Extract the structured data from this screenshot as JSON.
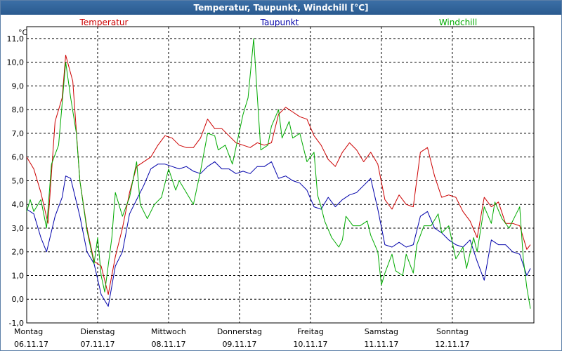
{
  "window": {
    "title": "Temperatur, Taupunkt, Windchill [°C]"
  },
  "chart_data": {
    "type": "line",
    "title": "Temperatur, Taupunkt, Windchill [°C]",
    "ylabel": "°C",
    "ylim": [
      -1,
      11.5
    ],
    "xlim": [
      0,
      7.15
    ],
    "grid": true,
    "legend_placement": "top",
    "y_ticks": [
      "11,0",
      "10,0",
      "9,0",
      "8,0",
      "7,0",
      "6,0",
      "5,0",
      "4,0",
      "3,0",
      "2,0",
      "1,0",
      "0,0",
      "-1,0"
    ],
    "x_ticks": [
      {
        "day": "Montag",
        "date": "06.11.17"
      },
      {
        "day": "Dienstag",
        "date": "07.11.17"
      },
      {
        "day": "Mittwoch",
        "date": "08.11.17"
      },
      {
        "day": "Donnerstag",
        "date": "09.11.17"
      },
      {
        "day": "Freitag",
        "date": "10.11.17"
      },
      {
        "day": "Samstag",
        "date": "11.11.17"
      },
      {
        "day": "Sonntag",
        "date": "12.11.17"
      }
    ],
    "series": [
      {
        "name": "Temperatur",
        "color": "#cc0000",
        "points": [
          [
            0,
            6
          ],
          [
            0.1,
            5.5
          ],
          [
            0.2,
            4.5
          ],
          [
            0.3,
            3.2
          ],
          [
            0.4,
            7.5
          ],
          [
            0.5,
            8.5
          ],
          [
            0.55,
            10.3
          ],
          [
            0.65,
            9.2
          ],
          [
            0.75,
            5
          ],
          [
            0.85,
            3
          ],
          [
            0.95,
            1.6
          ],
          [
            1.05,
            1.4
          ],
          [
            1.15,
            0.2
          ],
          [
            1.25,
            1.8
          ],
          [
            1.35,
            3
          ],
          [
            1.45,
            4.5
          ],
          [
            1.55,
            5.6
          ],
          [
            1.65,
            5.8
          ],
          [
            1.75,
            6
          ],
          [
            1.85,
            6.5
          ],
          [
            1.95,
            6.9
          ],
          [
            2.05,
            6.8
          ],
          [
            2.15,
            6.5
          ],
          [
            2.25,
            6.4
          ],
          [
            2.35,
            6.4
          ],
          [
            2.45,
            6.8
          ],
          [
            2.55,
            7.6
          ],
          [
            2.65,
            7.2
          ],
          [
            2.75,
            7.2
          ],
          [
            2.85,
            6.9
          ],
          [
            2.95,
            6.6
          ],
          [
            3.05,
            6.5
          ],
          [
            3.15,
            6.4
          ],
          [
            3.25,
            6.6
          ],
          [
            3.35,
            6.5
          ],
          [
            3.45,
            6.6
          ],
          [
            3.55,
            7.8
          ],
          [
            3.65,
            8.1
          ],
          [
            3.75,
            7.9
          ],
          [
            3.85,
            7.7
          ],
          [
            3.95,
            7.6
          ],
          [
            4.05,
            6.9
          ],
          [
            4.15,
            6.5
          ],
          [
            4.25,
            5.9
          ],
          [
            4.35,
            5.6
          ],
          [
            4.45,
            6.2
          ],
          [
            4.55,
            6.6
          ],
          [
            4.65,
            6.3
          ],
          [
            4.75,
            5.8
          ],
          [
            4.85,
            6.2
          ],
          [
            4.95,
            5.7
          ],
          [
            5.05,
            4.2
          ],
          [
            5.15,
            3.8
          ],
          [
            5.25,
            4.4
          ],
          [
            5.35,
            4.0
          ],
          [
            5.45,
            3.9
          ],
          [
            5.55,
            6.2
          ],
          [
            5.65,
            6.4
          ],
          [
            5.75,
            5.2
          ],
          [
            5.85,
            4.3
          ],
          [
            5.95,
            4.4
          ],
          [
            6.05,
            4.3
          ],
          [
            6.15,
            3.7
          ],
          [
            6.25,
            3.3
          ],
          [
            6.35,
            2.6
          ],
          [
            6.45,
            4.3
          ],
          [
            6.55,
            3.9
          ],
          [
            6.65,
            4.1
          ],
          [
            6.75,
            3.2
          ],
          [
            6.85,
            3.2
          ],
          [
            6.95,
            3.1
          ],
          [
            7.05,
            2.1
          ],
          [
            7.1,
            2.3
          ]
        ]
      },
      {
        "name": "Taupunkt",
        "color": "#0000aa",
        "points": [
          [
            0,
            3.8
          ],
          [
            0.1,
            3.6
          ],
          [
            0.2,
            2.6
          ],
          [
            0.28,
            2
          ],
          [
            0.4,
            3.5
          ],
          [
            0.5,
            4.3
          ],
          [
            0.55,
            5.2
          ],
          [
            0.62,
            5.1
          ],
          [
            0.75,
            3.5
          ],
          [
            0.85,
            2.0
          ],
          [
            0.95,
            1.5
          ],
          [
            1.05,
            0.2
          ],
          [
            1.15,
            -0.3
          ],
          [
            1.25,
            1.4
          ],
          [
            1.35,
            2.0
          ],
          [
            1.45,
            3.6
          ],
          [
            1.55,
            4.2
          ],
          [
            1.65,
            4.8
          ],
          [
            1.75,
            5.5
          ],
          [
            1.85,
            5.7
          ],
          [
            1.95,
            5.7
          ],
          [
            2.05,
            5.6
          ],
          [
            2.15,
            5.5
          ],
          [
            2.25,
            5.6
          ],
          [
            2.35,
            5.4
          ],
          [
            2.45,
            5.3
          ],
          [
            2.55,
            5.6
          ],
          [
            2.65,
            5.8
          ],
          [
            2.75,
            5.5
          ],
          [
            2.85,
            5.5
          ],
          [
            2.95,
            5.3
          ],
          [
            3.05,
            5.4
          ],
          [
            3.15,
            5.3
          ],
          [
            3.25,
            5.6
          ],
          [
            3.35,
            5.6
          ],
          [
            3.45,
            5.8
          ],
          [
            3.55,
            5.1
          ],
          [
            3.65,
            5.2
          ],
          [
            3.75,
            5
          ],
          [
            3.85,
            4.9
          ],
          [
            3.95,
            4.6
          ],
          [
            4.05,
            3.9
          ],
          [
            4.15,
            3.8
          ],
          [
            4.25,
            4.3
          ],
          [
            4.35,
            3.9
          ],
          [
            4.45,
            4.2
          ],
          [
            4.55,
            4.4
          ],
          [
            4.65,
            4.5
          ],
          [
            4.75,
            4.8
          ],
          [
            4.85,
            5.1
          ],
          [
            4.95,
            3.8
          ],
          [
            5.05,
            2.3
          ],
          [
            5.15,
            2.2
          ],
          [
            5.25,
            2.4
          ],
          [
            5.35,
            2.2
          ],
          [
            5.45,
            2.3
          ],
          [
            5.55,
            3.5
          ],
          [
            5.65,
            3.7
          ],
          [
            5.75,
            3.0
          ],
          [
            5.85,
            2.8
          ],
          [
            5.95,
            2.5
          ],
          [
            6.05,
            2.3
          ],
          [
            6.15,
            2.2
          ],
          [
            6.25,
            2.5
          ],
          [
            6.35,
            1.6
          ],
          [
            6.45,
            0.8
          ],
          [
            6.55,
            2.5
          ],
          [
            6.65,
            2.3
          ],
          [
            6.75,
            2.3
          ],
          [
            6.85,
            2.0
          ],
          [
            6.95,
            1.9
          ],
          [
            7.05,
            1.0
          ],
          [
            7.1,
            1.3
          ]
        ]
      },
      {
        "name": "Windchill",
        "color": "#00aa00",
        "points": [
          [
            0,
            3.7
          ],
          [
            0.05,
            4.2
          ],
          [
            0.1,
            3.7
          ],
          [
            0.2,
            4.2
          ],
          [
            0.28,
            3.0
          ],
          [
            0.35,
            5.7
          ],
          [
            0.45,
            6.5
          ],
          [
            0.55,
            10.0
          ],
          [
            0.62,
            8.5
          ],
          [
            0.7,
            7.0
          ],
          [
            0.75,
            5.0
          ],
          [
            0.85,
            2.9
          ],
          [
            0.95,
            1.5
          ],
          [
            1.0,
            2.6
          ],
          [
            1.05,
            1.0
          ],
          [
            1.1,
            0.3
          ],
          [
            1.2,
            2.6
          ],
          [
            1.25,
            4.5
          ],
          [
            1.35,
            3.5
          ],
          [
            1.45,
            4.3
          ],
          [
            1.55,
            5.8
          ],
          [
            1.6,
            4.0
          ],
          [
            1.7,
            3.4
          ],
          [
            1.8,
            4.0
          ],
          [
            1.9,
            4.3
          ],
          [
            2.0,
            5.5
          ],
          [
            2.1,
            4.6
          ],
          [
            2.15,
            5.0
          ],
          [
            2.25,
            4.5
          ],
          [
            2.35,
            4.0
          ],
          [
            2.45,
            5.4
          ],
          [
            2.55,
            7.0
          ],
          [
            2.65,
            6.9
          ],
          [
            2.7,
            6.3
          ],
          [
            2.8,
            6.5
          ],
          [
            2.9,
            5.7
          ],
          [
            2.95,
            6.4
          ],
          [
            3.05,
            7.8
          ],
          [
            3.12,
            8.5
          ],
          [
            3.2,
            11.0
          ],
          [
            3.25,
            8.6
          ],
          [
            3.3,
            6.3
          ],
          [
            3.4,
            6.5
          ],
          [
            3.45,
            7.3
          ],
          [
            3.55,
            8.0
          ],
          [
            3.6,
            6.8
          ],
          [
            3.7,
            7.5
          ],
          [
            3.75,
            6.8
          ],
          [
            3.85,
            7.0
          ],
          [
            3.95,
            5.8
          ],
          [
            4.05,
            6.2
          ],
          [
            4.1,
            4.4
          ],
          [
            4.15,
            3.9
          ],
          [
            4.2,
            3.3
          ],
          [
            4.3,
            2.6
          ],
          [
            4.4,
            2.2
          ],
          [
            4.45,
            2.5
          ],
          [
            4.5,
            3.5
          ],
          [
            4.6,
            3.1
          ],
          [
            4.7,
            3.1
          ],
          [
            4.8,
            3.3
          ],
          [
            4.85,
            2.7
          ],
          [
            4.95,
            2.0
          ],
          [
            5.0,
            0.6
          ],
          [
            5.05,
            1.1
          ],
          [
            5.15,
            1.9
          ],
          [
            5.2,
            1.2
          ],
          [
            5.3,
            1.0
          ],
          [
            5.35,
            1.9
          ],
          [
            5.45,
            1.1
          ],
          [
            5.5,
            2.3
          ],
          [
            5.6,
            3.1
          ],
          [
            5.7,
            3.1
          ],
          [
            5.8,
            3.6
          ],
          [
            5.85,
            2.8
          ],
          [
            5.95,
            3.1
          ],
          [
            6.05,
            1.7
          ],
          [
            6.15,
            2.2
          ],
          [
            6.2,
            1.3
          ],
          [
            6.3,
            2.6
          ],
          [
            6.35,
            2.0
          ],
          [
            6.45,
            3.9
          ],
          [
            6.55,
            3.2
          ],
          [
            6.6,
            4.1
          ],
          [
            6.7,
            3.4
          ],
          [
            6.8,
            3.0
          ],
          [
            6.9,
            3.6
          ],
          [
            6.95,
            3.9
          ],
          [
            7.0,
            1.7
          ],
          [
            7.05,
            0.5
          ],
          [
            7.1,
            -0.4
          ]
        ]
      }
    ]
  }
}
